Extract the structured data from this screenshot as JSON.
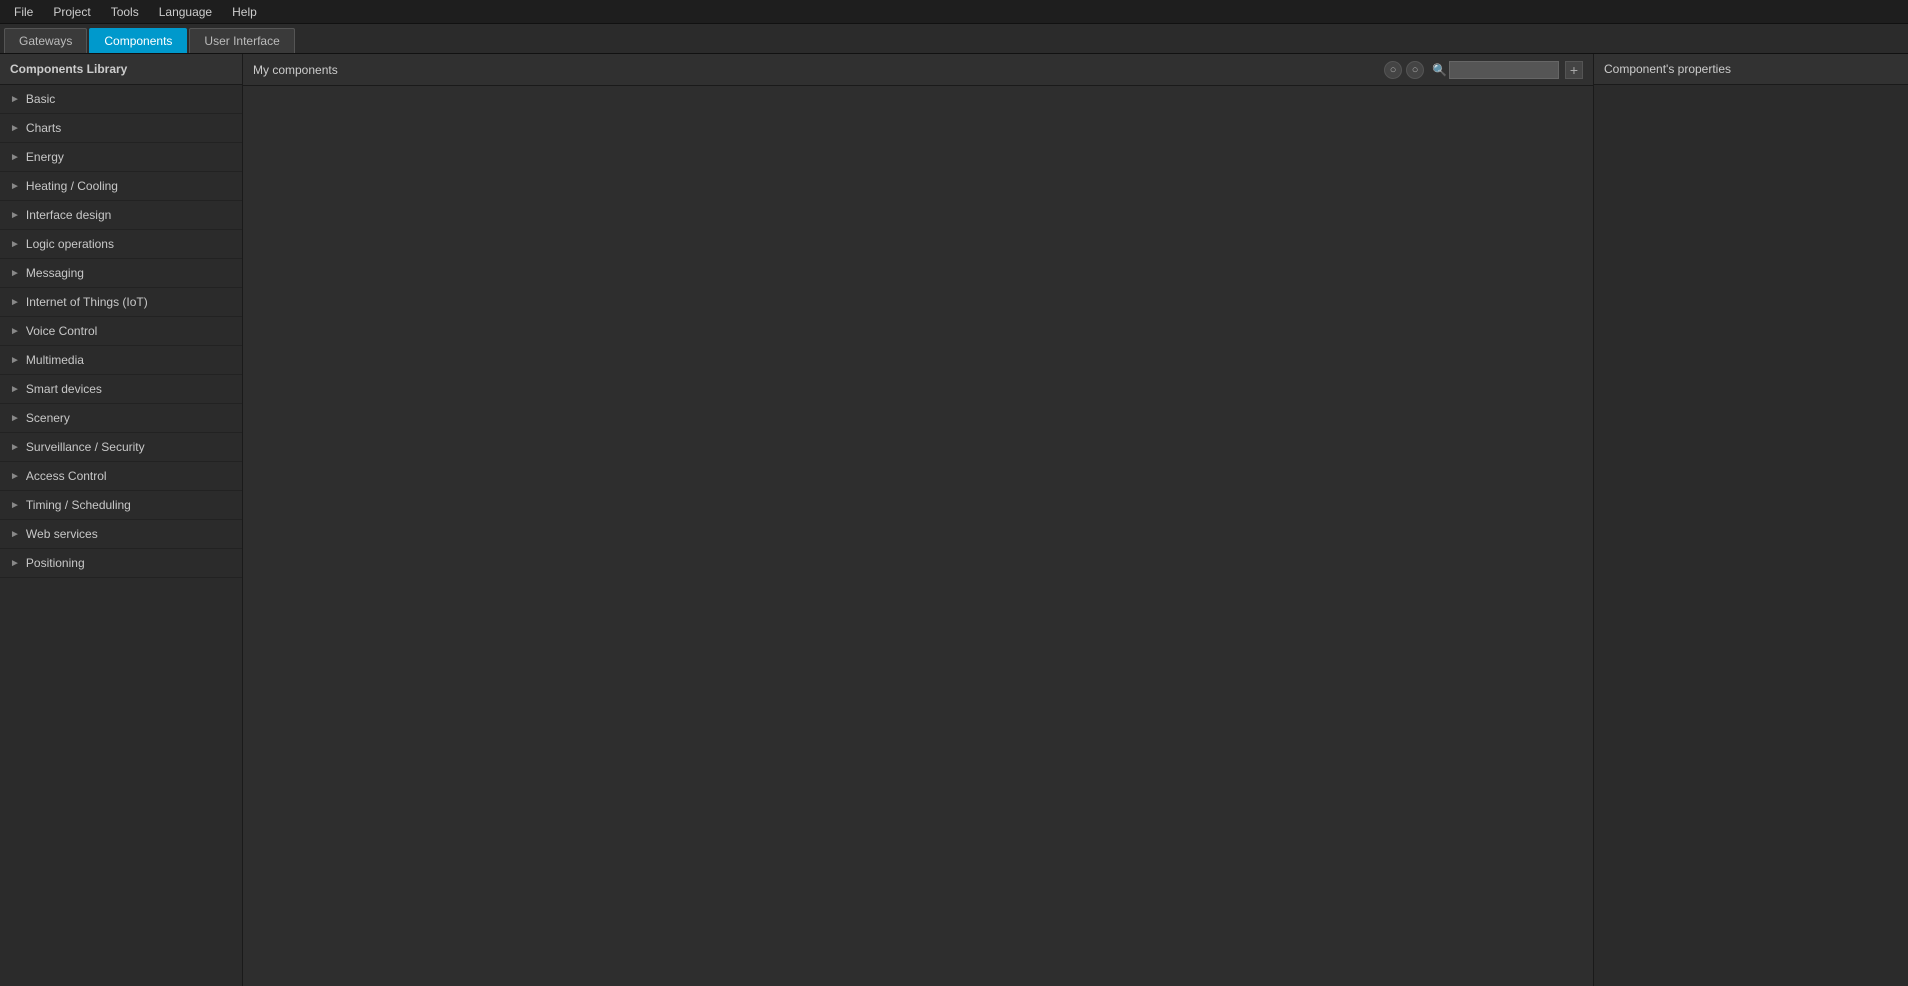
{
  "menu": {
    "items": [
      {
        "label": "File",
        "id": "file"
      },
      {
        "label": "Project",
        "id": "project"
      },
      {
        "label": "Tools",
        "id": "tools"
      },
      {
        "label": "Language",
        "id": "language"
      },
      {
        "label": "Help",
        "id": "help"
      }
    ]
  },
  "tabs": [
    {
      "label": "Gateways",
      "id": "gateways",
      "active": false
    },
    {
      "label": "Components",
      "id": "components",
      "active": true
    },
    {
      "label": "User Interface",
      "id": "user-interface",
      "active": false
    }
  ],
  "sidebar": {
    "title": "Components Library",
    "items": [
      {
        "label": "Basic",
        "id": "basic"
      },
      {
        "label": "Charts",
        "id": "charts"
      },
      {
        "label": "Energy",
        "id": "energy"
      },
      {
        "label": "Heating / Cooling",
        "id": "heating-cooling"
      },
      {
        "label": "Interface design",
        "id": "interface-design"
      },
      {
        "label": "Logic operations",
        "id": "logic-operations"
      },
      {
        "label": "Messaging",
        "id": "messaging"
      },
      {
        "label": "Internet of Things (IoT)",
        "id": "iot"
      },
      {
        "label": "Voice Control",
        "id": "voice-control"
      },
      {
        "label": "Multimedia",
        "id": "multimedia"
      },
      {
        "label": "Smart devices",
        "id": "smart-devices"
      },
      {
        "label": "Scenery",
        "id": "scenery"
      },
      {
        "label": "Surveillance / Security",
        "id": "surveillance-security"
      },
      {
        "label": "Access Control",
        "id": "access-control"
      },
      {
        "label": "Timing / Scheduling",
        "id": "timing-scheduling"
      },
      {
        "label": "Web services",
        "id": "web-services"
      },
      {
        "label": "Positioning",
        "id": "positioning"
      }
    ]
  },
  "content": {
    "title": "My components",
    "search_placeholder": "",
    "btn_circle1": "◯",
    "btn_circle2": "◯",
    "btn_add": "+"
  },
  "properties": {
    "title": "Component's properties"
  }
}
